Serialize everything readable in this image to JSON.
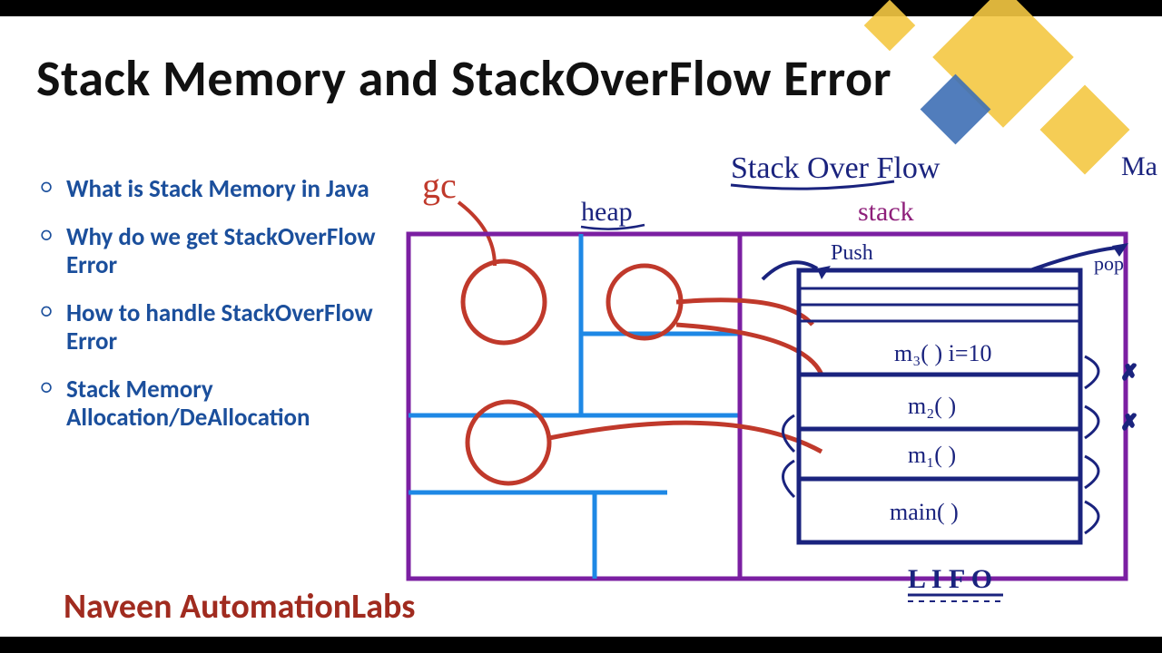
{
  "title": "Stack Memory and StackOverFlow Error",
  "credit": "Naveen AutomationLabs",
  "bullets": [
    "What is Stack Memory in Java",
    "Why do we get StackOverFlow Error",
    "How to handle StackOverFlow Error",
    "Stack Memory Allocation/DeAllocation"
  ],
  "colors": {
    "bullet": "#1b4f9c",
    "credit": "#a02b1f",
    "accent": "#f4c842"
  },
  "sketch": {
    "top_title": "Stack Over Flow",
    "gc_label": "gc",
    "heap_label": "heap",
    "stack_label": "stack",
    "push_label": "Push",
    "pop_label": "pop",
    "lifo_label": "L I F O",
    "frames": [
      "m₃( ) i=10",
      "m₂( )",
      "m₁( )",
      "main( )"
    ],
    "edge_right_label": "Ma"
  }
}
